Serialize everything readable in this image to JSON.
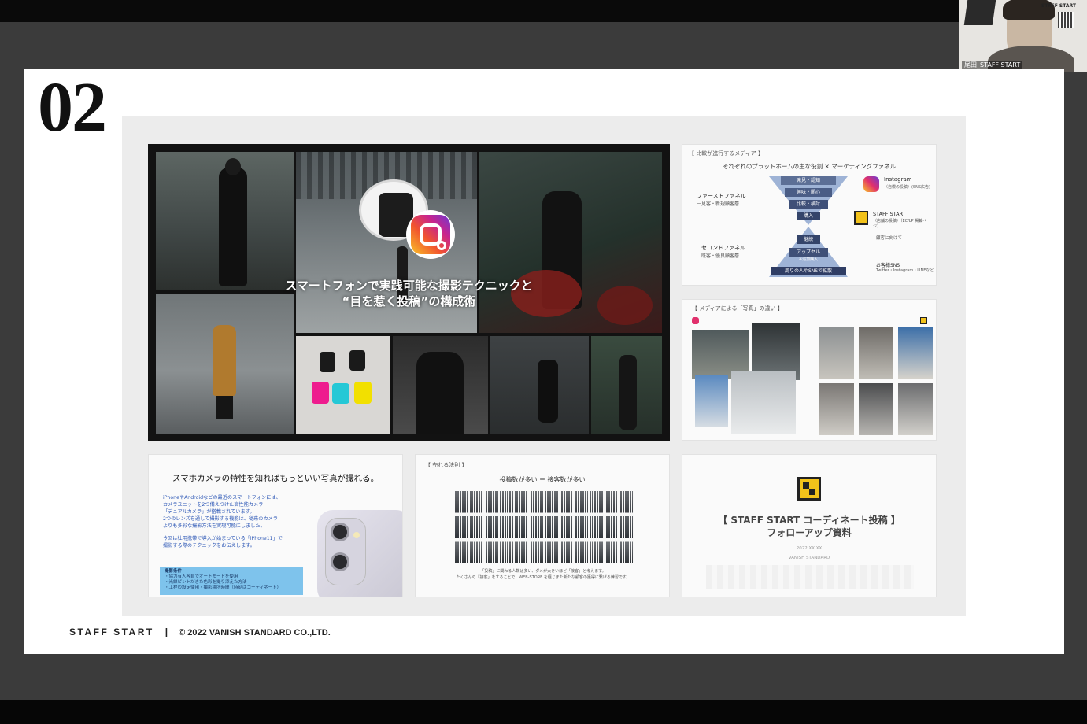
{
  "slide": {
    "number": "02",
    "hero_title_line1": "スマートフォンで実践可能な撮影テクニックと",
    "hero_title_line2": "“目を惹く投稿”の構成術",
    "footer_brand": "STAFF START",
    "footer_separator": "|",
    "footer_copyright": "© 2022 VANISH STANDARD CO.,LTD."
  },
  "card_funnel": {
    "header": "【 比較が進行するメディア 】",
    "title": "それぞれのプラットホームの主な役割 × マーケティングファネル",
    "left_top": "ファーストファネル",
    "left_top_sub": "一見客・新規顧客層",
    "left_bottom": "セロンドファネル",
    "left_bottom_sub": "既客・優良顧客層",
    "stages": [
      "発見・認知",
      "興味・関心",
      "比較・検討",
      "購入",
      "継続",
      "アップセル",
      "周りの人やSNSで拡散"
    ],
    "stage_sub": "※追加購入",
    "right_instagram": "Instagram",
    "right_instagram_sub": "（自慢の投稿）(SNS広告)",
    "right_staffstart": "STAFF START",
    "right_staffstart_sub": "（店舗の投稿）（EC/LP 掲載ページ）",
    "right_note": "顧客に向けて",
    "right_bottom": "お客様SNS",
    "right_bottom_sub": "Twitter・Instagram・LINEなど"
  },
  "card_media_photos": {
    "header": "【 メディアによる「写真」の違い 】"
  },
  "card_smartphone": {
    "title": "スマホカメラの特性を知ればもっといい写真が撮れる。",
    "body_line1": "iPhoneやAndroidなどの最近のスマートフォンには、",
    "body_line2": "カメラユニットを2つ備えつけた高性能カメラ",
    "body_line3": "「デュアルカメラ」が搭載されています。",
    "body_line4": "2つのレンズを通して撮影する機能は、従来のカメラ",
    "body_line5": "よりも多彩な撮影方法を実現可能にしました。",
    "body_line6": "今回は社用携帯で導入が始まっている「iPhone11」で",
    "body_line7": "撮影する際のテクニックをお伝えします。",
    "box_title": "撮影条件",
    "box_line1": "・協力有人各自でオートモードを使用",
    "box_line2": "・光線ピントがきた色彩を撮り添えた方法",
    "box_line3": "・工程の設定使用・撮影場所時間（時刻はコーディネート）"
  },
  "card_sales_law": {
    "header": "【 売れる法則 】",
    "title": "投稿数が多い ＝ 接客数が多い",
    "note_line1": "「投稿」に関わる人数は多い、ダメが大きいほど「接客」と考えます。",
    "note_line2": "たくさんの「接客」をすることで、WEB-STORE を経じまた新たな顧客の獲得に繋げる練習です。"
  },
  "card_followup": {
    "title_line1": "【 STAFF START コーディネート投稿 】",
    "title_line2": "フォローアップ資料",
    "sub_line1": "2022.XX.XX",
    "sub_line2": "VANISH STANDARD"
  },
  "video": {
    "participant_label": "尾田_STAFF START",
    "badge_brand": "STAFF START"
  },
  "colors": {
    "accent_yellow": "#f2c21a",
    "instagram_gradient": "#e1306c",
    "funnel_navy": "#2f3d64",
    "info_box_blue": "#7ec3ec"
  }
}
